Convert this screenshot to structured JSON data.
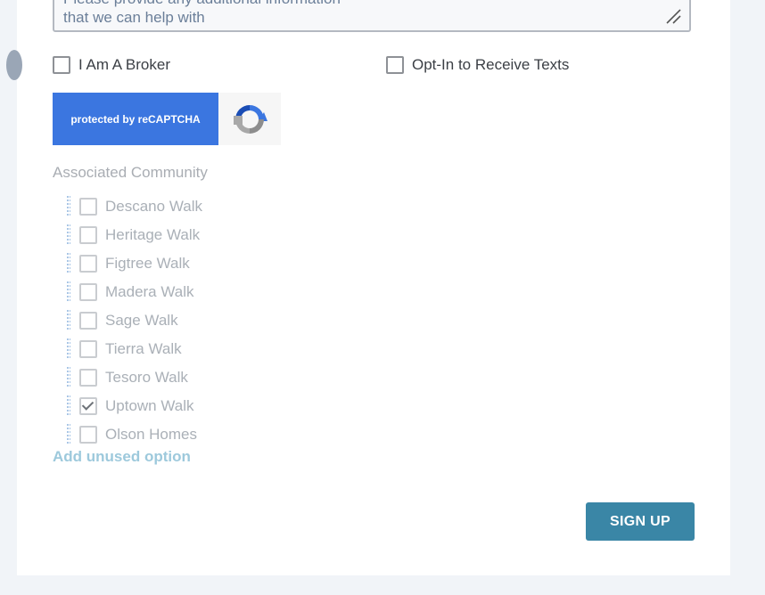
{
  "textarea": {
    "line1": "Please provide any additional information",
    "line2": "that we can help with"
  },
  "checkboxes": {
    "broker": {
      "label": "I Am A Broker",
      "checked": false
    },
    "opt_in": {
      "label": "Opt-In to Receive Texts",
      "checked": false
    }
  },
  "captcha": {
    "label": "protected by reCAPTCHA",
    "icon": "recaptcha-logo-icon"
  },
  "associated_community": {
    "title": "Associated Community",
    "items": [
      {
        "label": "Descano Walk",
        "checked": false
      },
      {
        "label": "Heritage Walk",
        "checked": false
      },
      {
        "label": "Figtree Walk",
        "checked": false
      },
      {
        "label": "Madera Walk",
        "checked": false
      },
      {
        "label": "Sage Walk",
        "checked": false
      },
      {
        "label": "Tierra Walk",
        "checked": false
      },
      {
        "label": "Tesoro Walk",
        "checked": false
      },
      {
        "label": "Uptown Walk",
        "checked": true
      },
      {
        "label": "Olson Homes",
        "checked": false
      }
    ],
    "add_unused": "Add unused option"
  },
  "actions": {
    "signup_label": "SIGN UP"
  },
  "colors": {
    "captcha_blue": "#3b76e0",
    "signup_button": "#3a86a6",
    "add_unused_link": "#9dc9dc"
  }
}
